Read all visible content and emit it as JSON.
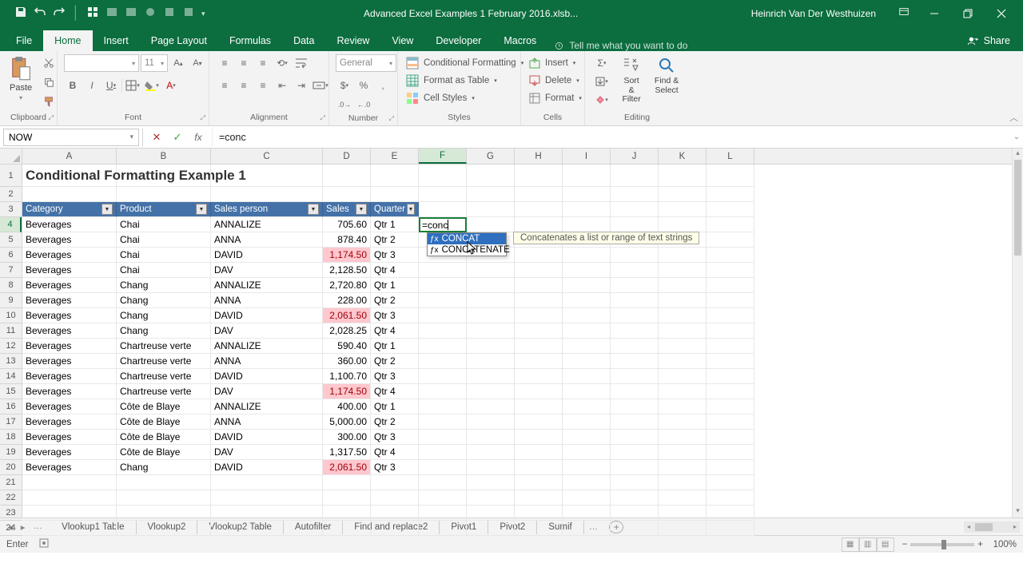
{
  "titlebar": {
    "filename": "Advanced Excel Examples 1 February 2016.xlsb...",
    "user": "Heinrich Van Der Westhuizen"
  },
  "ribbon": {
    "tabs": [
      "File",
      "Home",
      "Insert",
      "Page Layout",
      "Formulas",
      "Data",
      "Review",
      "View",
      "Developer",
      "Macros"
    ],
    "active_tab": 1,
    "tellme": "Tell me what you want to do",
    "share": "Share",
    "groups": {
      "clipboard": {
        "label": "Clipboard",
        "paste": "Paste"
      },
      "font": {
        "label": "Font",
        "family": "",
        "size": "11",
        "buttons": [
          "B",
          "I",
          "U"
        ]
      },
      "alignment": {
        "label": "Alignment"
      },
      "number": {
        "label": "Number",
        "format": "General"
      },
      "styles": {
        "label": "Styles",
        "cf": "Conditional Formatting",
        "ft": "Format as Table",
        "cs": "Cell Styles"
      },
      "cells": {
        "label": "Cells",
        "insert": "Insert",
        "delete": "Delete",
        "format": "Format"
      },
      "editing": {
        "label": "Editing",
        "sort": "Sort & Filter",
        "find": "Find & Select"
      }
    }
  },
  "formula_bar": {
    "name_box": "NOW",
    "formula": "=conc"
  },
  "columns": [
    "A",
    "B",
    "C",
    "D",
    "E",
    "F",
    "G",
    "H",
    "I",
    "J",
    "K",
    "L"
  ],
  "title": "Conditional Formatting Example 1",
  "headers": [
    "Category",
    "Product",
    "Sales person",
    "Sales",
    "Quarter"
  ],
  "rows": [
    {
      "n": 4,
      "c": "Beverages",
      "p": "Chai",
      "s": "ANNALIZE",
      "v": "705.60",
      "q": "Qtr 1",
      "hl": false
    },
    {
      "n": 5,
      "c": "Beverages",
      "p": "Chai",
      "s": "ANNA",
      "v": "878.40",
      "q": "Qtr 2",
      "hl": false
    },
    {
      "n": 6,
      "c": "Beverages",
      "p": "Chai",
      "s": "DAVID",
      "v": "1,174.50",
      "q": "Qtr 3",
      "hl": true
    },
    {
      "n": 7,
      "c": "Beverages",
      "p": "Chai",
      "s": "DAV",
      "v": "2,128.50",
      "q": "Qtr 4",
      "hl": false
    },
    {
      "n": 8,
      "c": "Beverages",
      "p": "Chang",
      "s": "ANNALIZE",
      "v": "2,720.80",
      "q": "Qtr 1",
      "hl": false
    },
    {
      "n": 9,
      "c": "Beverages",
      "p": "Chang",
      "s": "ANNA",
      "v": "228.00",
      "q": "Qtr 2",
      "hl": false
    },
    {
      "n": 10,
      "c": "Beverages",
      "p": "Chang",
      "s": "DAVID",
      "v": "2,061.50",
      "q": "Qtr 3",
      "hl": true
    },
    {
      "n": 11,
      "c": "Beverages",
      "p": "Chang",
      "s": "DAV",
      "v": "2,028.25",
      "q": "Qtr 4",
      "hl": false
    },
    {
      "n": 12,
      "c": "Beverages",
      "p": "Chartreuse   verte",
      "s": "ANNALIZE",
      "v": "590.40",
      "q": "Qtr 1",
      "hl": false
    },
    {
      "n": 13,
      "c": "Beverages",
      "p": "Chartreuse verte",
      "s": "ANNA",
      "v": "360.00",
      "q": "Qtr 2",
      "hl": false
    },
    {
      "n": 14,
      "c": "Beverages",
      "p": "Chartreuse verte",
      "s": "DAVID",
      "v": "1,100.70",
      "q": "Qtr 3",
      "hl": false
    },
    {
      "n": 15,
      "c": "Beverages",
      "p": "Chartreuse verte",
      "s": "DAV",
      "v": "1,174.50",
      "q": "Qtr 4",
      "hl": true
    },
    {
      "n": 16,
      "c": "Beverages",
      "p": "Côte de Blaye",
      "s": "ANNALIZE",
      "v": "400.00",
      "q": "Qtr 1",
      "hl": false
    },
    {
      "n": 17,
      "c": "Beverages",
      "p": "Côte de Blaye",
      "s": "ANNA",
      "v": "5,000.00",
      "q": "Qtr 2",
      "hl": false
    },
    {
      "n": 18,
      "c": "Beverages",
      "p": "Côte de Blaye",
      "s": "DAVID",
      "v": "300.00",
      "q": "Qtr 3",
      "hl": false
    },
    {
      "n": 19,
      "c": "Beverages",
      "p": "Côte de Blaye",
      "s": "DAV",
      "v": "1,317.50",
      "q": "Qtr 4",
      "hl": false
    },
    {
      "n": 20,
      "c": "Beverages",
      "p": "Chang",
      "s": "DAVID",
      "v": "2,061.50",
      "q": "Qtr 3",
      "hl": true
    }
  ],
  "editing": {
    "cell": "F4",
    "text": "=conc",
    "suggestions": [
      "CONCAT",
      "CONCATENATE"
    ],
    "selected": 0,
    "tip": "Concatenates a list or range of text strings"
  },
  "sheet_tabs": [
    "Vlookup1 Table",
    "Vlookup2",
    "Vlookup2 Table",
    "Autofilter",
    "Find and replace2",
    "Pivot1",
    "Pivot2",
    "Sumif"
  ],
  "status": {
    "mode": "Enter",
    "zoom": "100%"
  }
}
